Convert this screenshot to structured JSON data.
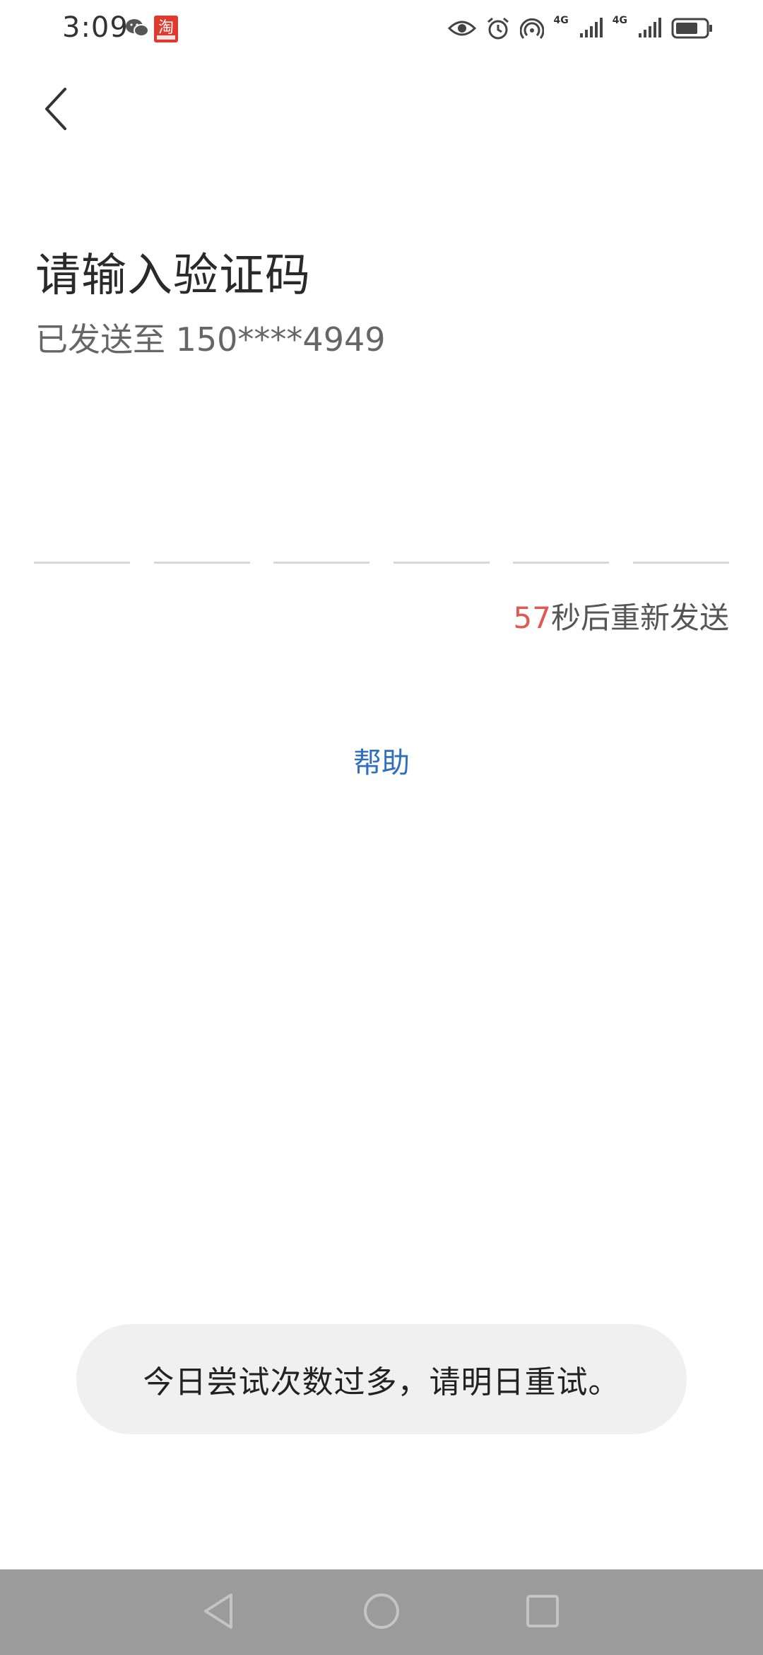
{
  "status_bar": {
    "time": "3:09",
    "network_1": "4G",
    "network_2": "4G",
    "icons": [
      "wechat-icon",
      "taobao-icon",
      "eye-icon",
      "alarm-icon",
      "hotspot-icon",
      "signal-icon",
      "signal-icon",
      "battery-icon"
    ],
    "taobao_glyph": "淘"
  },
  "header": {
    "title": "请输入验证码",
    "sent_to": "已发送至 150****4949"
  },
  "code_input": {
    "slots": 6
  },
  "resend": {
    "countdown": "57",
    "suffix": "秒后重新发送"
  },
  "help": {
    "label": "帮助"
  },
  "toast": {
    "message": "今日尝试次数过多，请明日重试。"
  },
  "colors": {
    "countdown": "#e05a4f",
    "link": "#2f6fc0",
    "nav_bar": "#9b9b9b",
    "toast_bg": "#f0f0f0"
  }
}
